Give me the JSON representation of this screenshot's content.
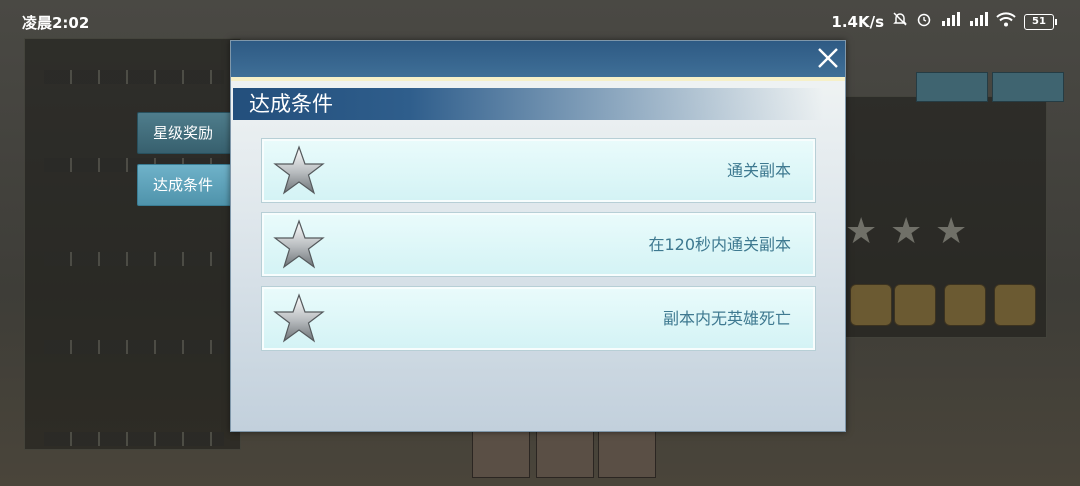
{
  "status_bar": {
    "time": "凌晨2:02",
    "net_speed": "1.4K/s",
    "battery": "51"
  },
  "side_tabs": [
    {
      "label": "星级奖励",
      "active": false
    },
    {
      "label": "达成条件",
      "active": true
    }
  ],
  "modal": {
    "title": "达成条件",
    "conditions": [
      {
        "text": "通关副本",
        "star": "silver"
      },
      {
        "text": "在120秒内通关副本",
        "star": "silver"
      },
      {
        "text": "副本内无英雄死亡",
        "star": "silver"
      }
    ]
  },
  "colors": {
    "header": "#2e5a84",
    "row_bg": "#dff7f8",
    "row_text": "#3e7990",
    "active_tab": "#5aa2ba"
  }
}
